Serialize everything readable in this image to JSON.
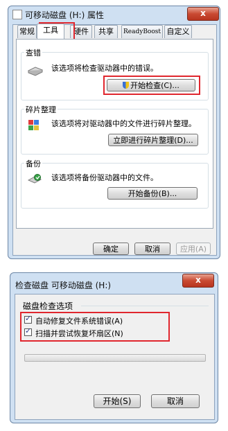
{
  "dialog1": {
    "title": "可移动磁盘 (H:) 属性",
    "close_label": "x",
    "tabs": [
      {
        "label": "常规"
      },
      {
        "label": "工具"
      },
      {
        "label": "硬件"
      },
      {
        "label": "共享"
      },
      {
        "label": "ReadyBoost"
      },
      {
        "label": "自定义"
      }
    ],
    "check": {
      "group_label": "查错",
      "description": "该选项将检查驱动器中的错误。",
      "button": "开始检查(C)..."
    },
    "defrag": {
      "group_label": "碎片整理",
      "description": "该选项将对驱动器中的文件进行碎片整理。",
      "button": "立即进行碎片整理(D)..."
    },
    "backup": {
      "group_label": "备份",
      "description": "该选项将备份驱动器中的文件。",
      "button": "开始备份(B)..."
    },
    "ok": "确定",
    "cancel": "取消",
    "apply": "应用(A)"
  },
  "dialog2": {
    "title": "检查磁盘 可移动磁盘 (H:)",
    "close_label": "x",
    "options_label": "磁盘检查选项",
    "option1": {
      "label": "自动修复文件系统错误(A)",
      "checked": true
    },
    "option2": {
      "label": "扫描并尝试恢复坏扇区(N)",
      "checked": true
    },
    "start": "开始(S)",
    "cancel": "取消"
  },
  "colors": {
    "highlight": "#e0262e",
    "titlebar": "#cfe0f2"
  }
}
